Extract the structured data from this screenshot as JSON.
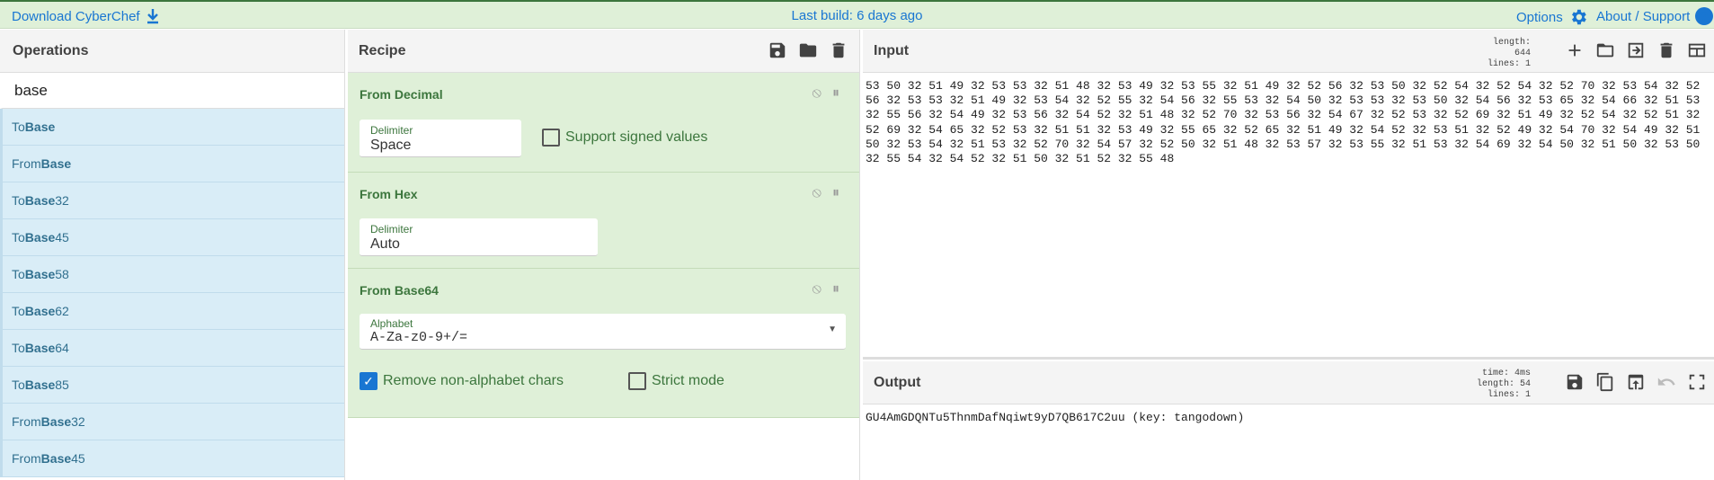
{
  "banner": {
    "download": "Download CyberChef",
    "build": "Last build: 6 days ago",
    "options": "Options",
    "about": "About / Support"
  },
  "operations": {
    "title": "Operations",
    "search_value": "base",
    "items": [
      {
        "pre": "To ",
        "match": "Base",
        "post": ""
      },
      {
        "pre": "From ",
        "match": "Base",
        "post": ""
      },
      {
        "pre": "To ",
        "match": "Base",
        "post": "32"
      },
      {
        "pre": "To ",
        "match": "Base",
        "post": "45"
      },
      {
        "pre": "To ",
        "match": "Base",
        "post": "58"
      },
      {
        "pre": "To ",
        "match": "Base",
        "post": "62"
      },
      {
        "pre": "To ",
        "match": "Base",
        "post": "64"
      },
      {
        "pre": "To ",
        "match": "Base",
        "post": "85"
      },
      {
        "pre": "From ",
        "match": "Base",
        "post": "32"
      },
      {
        "pre": "From ",
        "match": "Base",
        "post": "45"
      }
    ]
  },
  "recipe": {
    "title": "Recipe",
    "ops": {
      "decimal": {
        "name": "From Decimal",
        "delim_label": "Delimiter",
        "delim_value": "Space",
        "signed_label": "Support signed values"
      },
      "hex": {
        "name": "From Hex",
        "delim_label": "Delimiter",
        "delim_value": "Auto"
      },
      "b64": {
        "name": "From Base64",
        "alpha_label": "Alphabet",
        "alpha_value": "A-Za-z0-9+/=",
        "remove_label": "Remove non-alphabet chars",
        "strict_label": "Strict mode"
      }
    }
  },
  "input": {
    "title": "Input",
    "length_label": "length:",
    "length": "644",
    "lines_label": "lines:",
    "lines": "1",
    "text": "53 50 32 51 49 32 53 53 32 51 48 32 53 49 32 53 55 32 51 49 32 52 56 32 53 50 32 52 54 32 52 54 32 52 70 32 53 54 32 52 56 32 53 53 32 51 49 32 53 54 32 52 55 32 54 56 32 55 53 32 54 50 32 53 53 32 53 50 32 54 56 32 53 65 32 54 66 32 51 53 32 55 56 32 54 49 32 53 56 32 54 52 32 51 48 32 52 70 32 53 56 32 54 67 32 52 53 32 52 69 32 51 49 32 52 54 32 52 51 32 52 69 32 54 65 32 52 53 32 51 51 32 53 49 32 55 65 32 52 65 32 51 49 32 54 52 32 53 51 32 52 49 32 54 70 32 54 49 32 51 50 32 53 54 32 51 53 32 52 70 32 54 57 32 52 50 32 51 48 32 53 57 32 53 55 32 51 53 32 54 69 32 54 50 32 51 50 32 53 50 32 55 54 32 54 52 32 51 50 32 51 52 32 55 48"
  },
  "output": {
    "title": "Output",
    "time_label": "time:",
    "time": "4ms",
    "length_label": "length:",
    "length": "54",
    "lines_label": "lines:",
    "lines": "1",
    "text": "GU4AmGDQNTu5ThnmDafNqiwt9yD7QB617C2uu (key: tangodown)"
  },
  "colors": {
    "banner_bg": "#dff0d8",
    "link": "#1976d2",
    "op_bg": "#dff0d8",
    "op_text": "#3c763d",
    "list_bg": "#d9edf7"
  }
}
